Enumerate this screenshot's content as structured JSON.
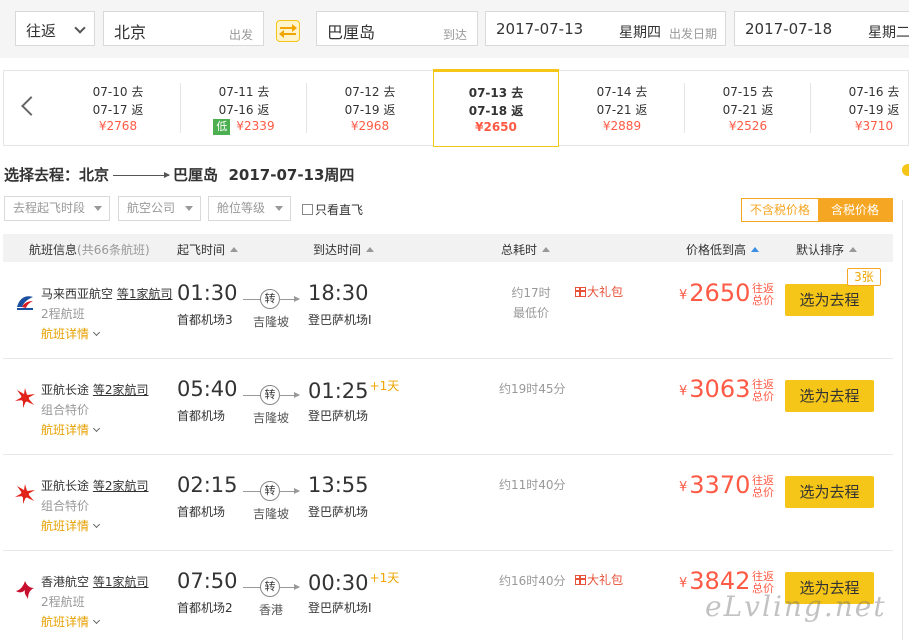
{
  "search": {
    "trip_type": "往返",
    "from_city": "北京",
    "from_tag": "出发",
    "to_city": "巴厘岛",
    "to_tag": "到达",
    "depart_date": "2017-07-13",
    "depart_weekday": "星期四",
    "depart_tag": "出发日期",
    "return_date": "2017-07-18",
    "return_weekday": "星期二"
  },
  "date_strip": [
    {
      "go": "07-10 去",
      "back": "07-17 返",
      "price": "¥2768",
      "low": ""
    },
    {
      "go": "07-11 去",
      "back": "07-16 返",
      "price": "¥2339",
      "low": "低"
    },
    {
      "go": "07-12 去",
      "back": "07-19 返",
      "price": "¥2968",
      "low": ""
    },
    {
      "go": "07-13 去",
      "back": "07-18 返",
      "price": "¥2650",
      "low": ""
    },
    {
      "go": "07-14 去",
      "back": "07-21 返",
      "price": "¥2889",
      "low": ""
    },
    {
      "go": "07-15 去",
      "back": "07-21 返",
      "price": "¥2526",
      "low": ""
    },
    {
      "go": "07-16 去",
      "back": "07-19 返",
      "price": "¥3710",
      "low": ""
    }
  ],
  "route": {
    "prefix": "选择去程：北京",
    "to": "巴厘岛",
    "date": "2017-07-13周四"
  },
  "filters": {
    "time": "去程起飞时段",
    "airline": "航空公司",
    "cabin": "舱位等级",
    "direct_only": "只看直飞",
    "price_excl_tax": "不含税价格",
    "price_incl_tax": "含税价格"
  },
  "columns": {
    "flight_info": "航班信息",
    "flight_count": "(共66条航班)",
    "depart_time": "起飞时间",
    "arrive_time": "到达时间",
    "duration": "总耗时",
    "price_sort": "价格低到高",
    "default_sort": "默认排序"
  },
  "flights": [
    {
      "airline": "马来西亚航空",
      "airline_more": "等1家航司",
      "fare_type": "2程航班",
      "detail": "航班详情",
      "dep_time": "01:30",
      "dep_airport": "首都机场3",
      "stop_label": "转",
      "stop_city": "吉隆坡",
      "arr_time": "18:30",
      "arr_plus": "",
      "arr_airport": "登巴萨机场I",
      "duration": "约17时",
      "duration_note": "最低价",
      "gift": "大礼包",
      "price_yen": "¥",
      "price": "2650",
      "price_tag": "往返总价",
      "select": "选为去程",
      "seats": "3张",
      "logo_color": "#1c4fa0"
    },
    {
      "airline": "亚航长途",
      "airline_more": "等2家航司",
      "fare_type": "组合特价",
      "detail": "航班详情",
      "dep_time": "05:40",
      "dep_airport": "首都机场",
      "stop_label": "转",
      "stop_city": "吉隆坡",
      "arr_time": "01:25",
      "arr_plus": "+1天",
      "arr_airport": "登巴萨机场",
      "duration": "约19时45分",
      "duration_note": "",
      "gift": "",
      "price_yen": "¥",
      "price": "3063",
      "price_tag": "往返总价",
      "select": "选为去程",
      "seats": "",
      "logo_color": "#e2231a"
    },
    {
      "airline": "亚航长途",
      "airline_more": "等2家航司",
      "fare_type": "组合特价",
      "detail": "航班详情",
      "dep_time": "02:15",
      "dep_airport": "首都机场",
      "stop_label": "转",
      "stop_city": "吉隆坡",
      "arr_time": "13:55",
      "arr_plus": "",
      "arr_airport": "登巴萨机场",
      "duration": "约11时40分",
      "duration_note": "",
      "gift": "",
      "price_yen": "¥",
      "price": "3370",
      "price_tag": "往返总价",
      "select": "选为去程",
      "seats": "",
      "logo_color": "#e2231a"
    },
    {
      "airline": "香港航空",
      "airline_more": "等1家航司",
      "fare_type": "2程航班",
      "detail": "航班详情",
      "dep_time": "07:50",
      "dep_airport": "首都机场2",
      "stop_label": "转",
      "stop_city": "香港",
      "arr_time": "00:30",
      "arr_plus": "+1天",
      "arr_airport": "登巴萨机场I",
      "duration": "约16时40分",
      "duration_note": "",
      "gift": "大礼包",
      "price_yen": "¥",
      "price": "3842",
      "price_tag": "往返总价",
      "select": "选为去程",
      "seats": "",
      "logo_color": "#c8102e"
    }
  ],
  "watermark": "eLvling.net"
}
